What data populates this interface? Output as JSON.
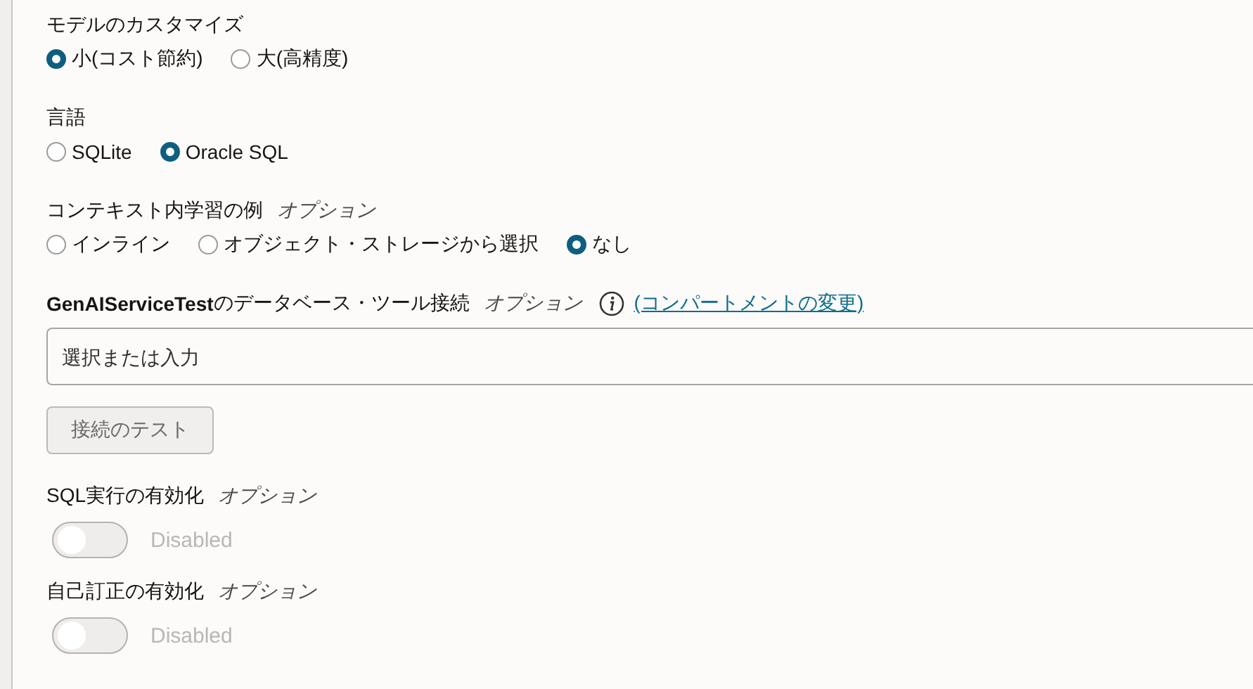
{
  "sections": [
    {
      "kind": "radio",
      "label": "モデルのカスタマイズ",
      "options": [
        {
          "label": "小(コスト節約)",
          "selected": true
        },
        {
          "label": "大(高精度)",
          "selected": false
        }
      ]
    },
    {
      "kind": "radio",
      "label": "言語",
      "options": [
        {
          "label": "SQLite",
          "selected": false
        },
        {
          "label": "Oracle SQL",
          "selected": true
        }
      ]
    },
    {
      "kind": "radio",
      "label": "コンテキスト内学習の例",
      "optional": "オプション",
      "options": [
        {
          "label": "インライン",
          "selected": false
        },
        {
          "label": "オブジェクト・ストレージから選択",
          "selected": false
        },
        {
          "label": "なし",
          "selected": true
        }
      ]
    },
    {
      "kind": "combobox",
      "label_bold": "GenAIServiceTest",
      "label": "のデータベース・ツール接続",
      "optional": "オプション",
      "info": true,
      "link": "(コンパートメントの変更)",
      "placeholder": "選択または入力",
      "button": "接続のテスト"
    },
    {
      "kind": "toggle",
      "label": "SQL実行の有効化",
      "optional": "オプション",
      "on": false,
      "state_text": "Disabled"
    },
    {
      "kind": "toggle",
      "label": "自己訂正の有効化",
      "optional": "オプション",
      "on": false,
      "state_text": "Disabled"
    }
  ]
}
